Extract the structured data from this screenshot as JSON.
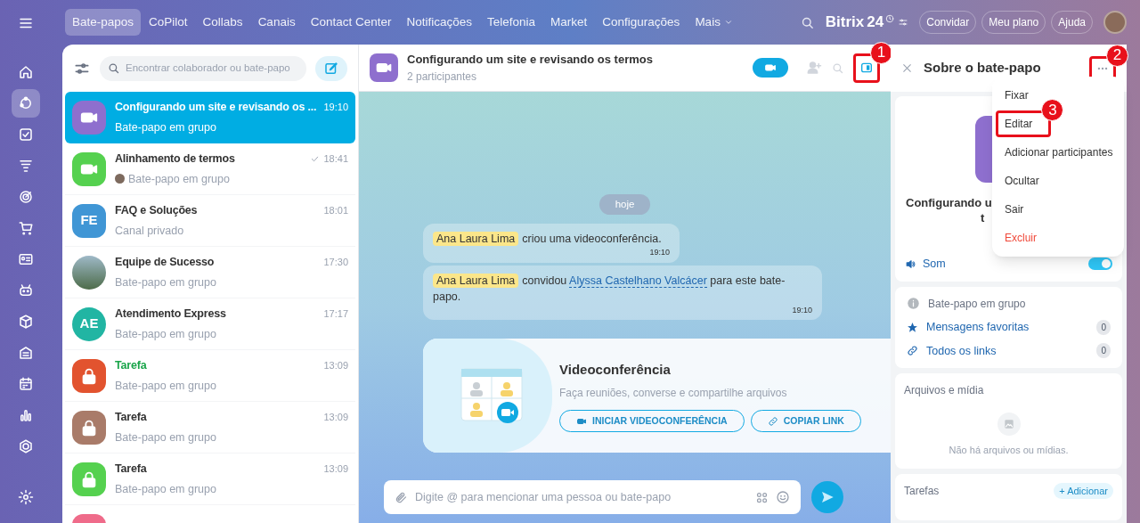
{
  "rail_items": [
    {
      "selected": false
    },
    {
      "selected": false
    },
    {
      "selected": true
    },
    {
      "selected": false
    },
    {
      "selected": false
    },
    {
      "selected": false
    },
    {
      "selected": false
    },
    {
      "selected": false
    },
    {
      "selected": false
    },
    {
      "selected": false
    },
    {
      "selected": false
    },
    {
      "selected": false
    },
    {
      "selected": false
    },
    {
      "selected": false
    },
    {
      "selected": false
    }
  ],
  "nav_tabs": [
    {
      "label": "Bate-papos",
      "selected": true
    },
    {
      "label": "CoPilot",
      "selected": false
    },
    {
      "label": "Collabs",
      "selected": false
    },
    {
      "label": "Canais",
      "selected": false
    },
    {
      "label": "Contact Center",
      "selected": false
    },
    {
      "label": "Notificações",
      "selected": false
    },
    {
      "label": "Telefonia",
      "selected": false
    },
    {
      "label": "Market",
      "selected": false
    },
    {
      "label": "Configurações",
      "selected": false
    },
    {
      "label": "Mais",
      "selected": false
    }
  ],
  "logo": {
    "name": "Bitrix",
    "number": "24"
  },
  "top_buttons": [
    "Convidar",
    "Meu plano",
    "Ajuda"
  ],
  "search": {
    "placeholder": "Encontrar colaborador ou bate-papo"
  },
  "chats": [
    {
      "title": "Configurando um site e revisando os ...",
      "subtitle": "Bate-papo em grupo",
      "time": "19:10",
      "kind": "video",
      "color": "#8e6fce",
      "selected": true,
      "read": false,
      "sender_avatar": false,
      "highlight": false
    },
    {
      "title": "Alinhamento de termos",
      "subtitle": "Bate-papo em grupo",
      "time": "18:41",
      "kind": "video",
      "color": "#55d14f",
      "selected": false,
      "read": true,
      "sender_avatar": true,
      "highlight": false
    },
    {
      "title": "FAQ e Soluções",
      "subtitle": "Canal privado",
      "time": "18:01",
      "kind": "initials",
      "initials": "FE",
      "color": "#4096d5",
      "selected": false,
      "read": false,
      "sender_avatar": false,
      "highlight": false
    },
    {
      "title": "Equipe de Sucesso",
      "subtitle": "Bate-papo em grupo",
      "time": "17:30",
      "kind": "photo",
      "color": "#6b8a6a",
      "selected": false,
      "read": false,
      "sender_avatar": false,
      "highlight": false
    },
    {
      "title": "Atendimento Express",
      "subtitle": "Bate-papo em grupo",
      "time": "17:17",
      "kind": "initials_round",
      "initials": "AE",
      "color": "#21b5a3",
      "selected": false,
      "read": false,
      "sender_avatar": false,
      "highlight": false
    },
    {
      "title": "Tarefa",
      "subtitle": "Bate-papo em grupo",
      "time": "13:09",
      "kind": "lock",
      "color": "#e2532f",
      "selected": false,
      "read": false,
      "sender_avatar": false,
      "highlight": true
    },
    {
      "title": "Tarefa",
      "subtitle": "Bate-papo em grupo",
      "time": "13:09",
      "kind": "lock",
      "color": "#a97b69",
      "selected": false,
      "read": false,
      "sender_avatar": false,
      "highlight": false
    },
    {
      "title": "Tarefa",
      "subtitle": "Bate-papo em grupo",
      "time": "13:09",
      "kind": "lock",
      "color": "#55d14f",
      "selected": false,
      "read": false,
      "sender_avatar": false,
      "highlight": false
    },
    {
      "kind": "lock",
      "color": "#ef6b8a",
      "selected": false
    }
  ],
  "chat_header": {
    "title": "Configurando um site e revisando os termos",
    "subtitle": "2 participantes"
  },
  "date_label": "hoje",
  "messages": [
    {
      "kind": "created",
      "author": "Ana Laura Lima",
      "text": "criou uma videoconferência.",
      "time": "19:10"
    },
    {
      "kind": "invited",
      "author": "Ana Laura Lima",
      "text": "convidou",
      "link": "Alyssa Castelhano Valcácer",
      "text_after": "para este bate-papo.",
      "time": "19:10"
    }
  ],
  "video_card": {
    "title": "Videoconferência",
    "description": "Faça reuniões, converse e compartilhe arquivos",
    "buttons": [
      {
        "kind": "video",
        "label": "INICIAR VIDEOCONFERÊNCIA"
      },
      {
        "kind": "link",
        "label": "COPIAR LINK"
      }
    ]
  },
  "composer": {
    "placeholder": "Digite @ para mencionar uma pessoa ou bate-papo"
  },
  "info_panel": {
    "title": "Sobre o bate-papo",
    "chat_title_lines": [
      "Configurando u",
      "t"
    ],
    "sound": {
      "label": "Som",
      "on": true
    },
    "type_label": "Bate-papo em grupo",
    "links": [
      {
        "kind": "favorites",
        "label": "Mensagens favoritas",
        "count": "0"
      },
      {
        "kind": "links",
        "label": "Todos os links",
        "count": "0"
      }
    ],
    "files": {
      "title": "Arquivos e mídia",
      "empty": "Não há arquivos ou mídias."
    },
    "tasks": {
      "title": "Tarefas",
      "add": "+ Adicionar"
    }
  },
  "menu": [
    {
      "label": "Fixar",
      "kind": "normal"
    },
    {
      "label": "Editar",
      "kind": "normal"
    },
    {
      "label": "Adicionar participantes",
      "kind": "normal"
    },
    {
      "label": "Ocultar",
      "kind": "normal"
    },
    {
      "label": "Sair",
      "kind": "normal"
    },
    {
      "label": "Excluir",
      "kind": "danger"
    }
  ],
  "annotations": [
    {
      "number": "1"
    },
    {
      "number": "2"
    },
    {
      "number": "3"
    }
  ]
}
